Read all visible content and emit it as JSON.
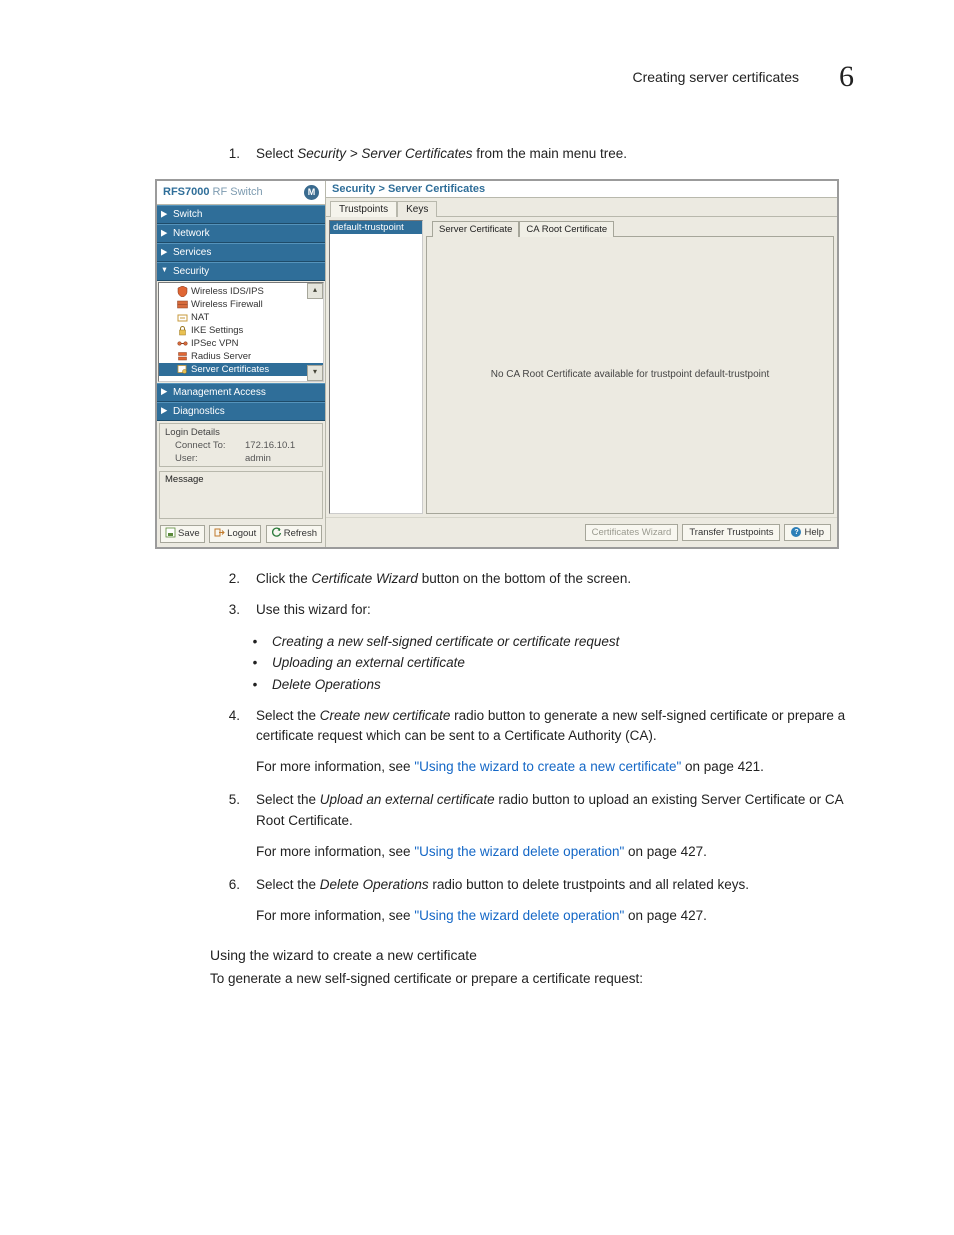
{
  "header": {
    "title": "Creating server certificates",
    "chapter": "6"
  },
  "steps": {
    "s1": {
      "num": "1.",
      "pre": "Select ",
      "em": "Security > Server Certificates",
      "post": " from the main menu tree."
    },
    "s2": {
      "num": "2.",
      "pre": "Click the ",
      "em": "Certificate Wizard",
      "post": " button on the bottom of the screen."
    },
    "s3": {
      "num": "3.",
      "txt": "Use this wizard for:"
    },
    "s3b": {
      "b1": "Creating a new self-signed certificate or certificate request",
      "b2": "Uploading an external certificate",
      "b3": "Delete Operations"
    },
    "s4": {
      "num": "4.",
      "pre": "Select the ",
      "em": "Create new certificate",
      "post": " radio button to generate a new self-signed certificate or prepare a certificate request which can be sent to a Certificate Authority (CA)."
    },
    "s4l": {
      "pre": "For more information, see ",
      "link": "\"Using the wizard to create a new certificate\"",
      "post": " on page 421."
    },
    "s5": {
      "num": "5.",
      "pre": "Select the ",
      "em": "Upload an external certificate",
      "post": " radio button to upload an existing Server Certificate or CA Root Certificate."
    },
    "s5l": {
      "pre": "For more information, see ",
      "link": "\"Using the wizard delete operation\"",
      "post": " on page 427."
    },
    "s6": {
      "num": "6.",
      "pre": "Select the ",
      "em": "Delete Operations",
      "post": " radio button to delete trustpoints and all related keys."
    },
    "s6l": {
      "pre": "For more information, see ",
      "link": "\"Using the wizard delete operation\"",
      "post": " on page 427."
    }
  },
  "subsection": {
    "title": "Using the wizard to create a new certificate",
    "para": "To generate a new self-signed certificate or prepare a certificate request:"
  },
  "ui": {
    "nav": {
      "title_bold": "RFS7000",
      "title_faint": "RF Switch",
      "logo": "M",
      "sections": [
        "Switch",
        "Network",
        "Services",
        "Security",
        "Management Access",
        "Diagnostics"
      ],
      "tree": [
        "Wireless IDS/IPS",
        "Wireless Firewall",
        "NAT",
        "IKE Settings",
        "IPSec VPN",
        "Radius Server",
        "Server Certificates"
      ],
      "login": {
        "legend": "Login Details",
        "connect_k": "Connect To:",
        "connect_v": "172.16.10.1",
        "user_k": "User:",
        "user_v": "admin"
      },
      "message": "Message",
      "btns": {
        "save": "Save",
        "logout": "Logout",
        "refresh": "Refresh"
      }
    },
    "main": {
      "title": "Security > Server Certificates",
      "tabs": [
        "Trustpoints",
        "Keys"
      ],
      "trustpoints": [
        "default-trustpoint"
      ],
      "cert_tabs": [
        "Server Certificate",
        "CA Root Certificate"
      ],
      "empty_msg": "No CA Root Certificate available for trustpoint default-trustpoint",
      "footer": {
        "wizard": "Certificates Wizard",
        "transfer": "Transfer Trustpoints",
        "help": "Help"
      }
    }
  }
}
